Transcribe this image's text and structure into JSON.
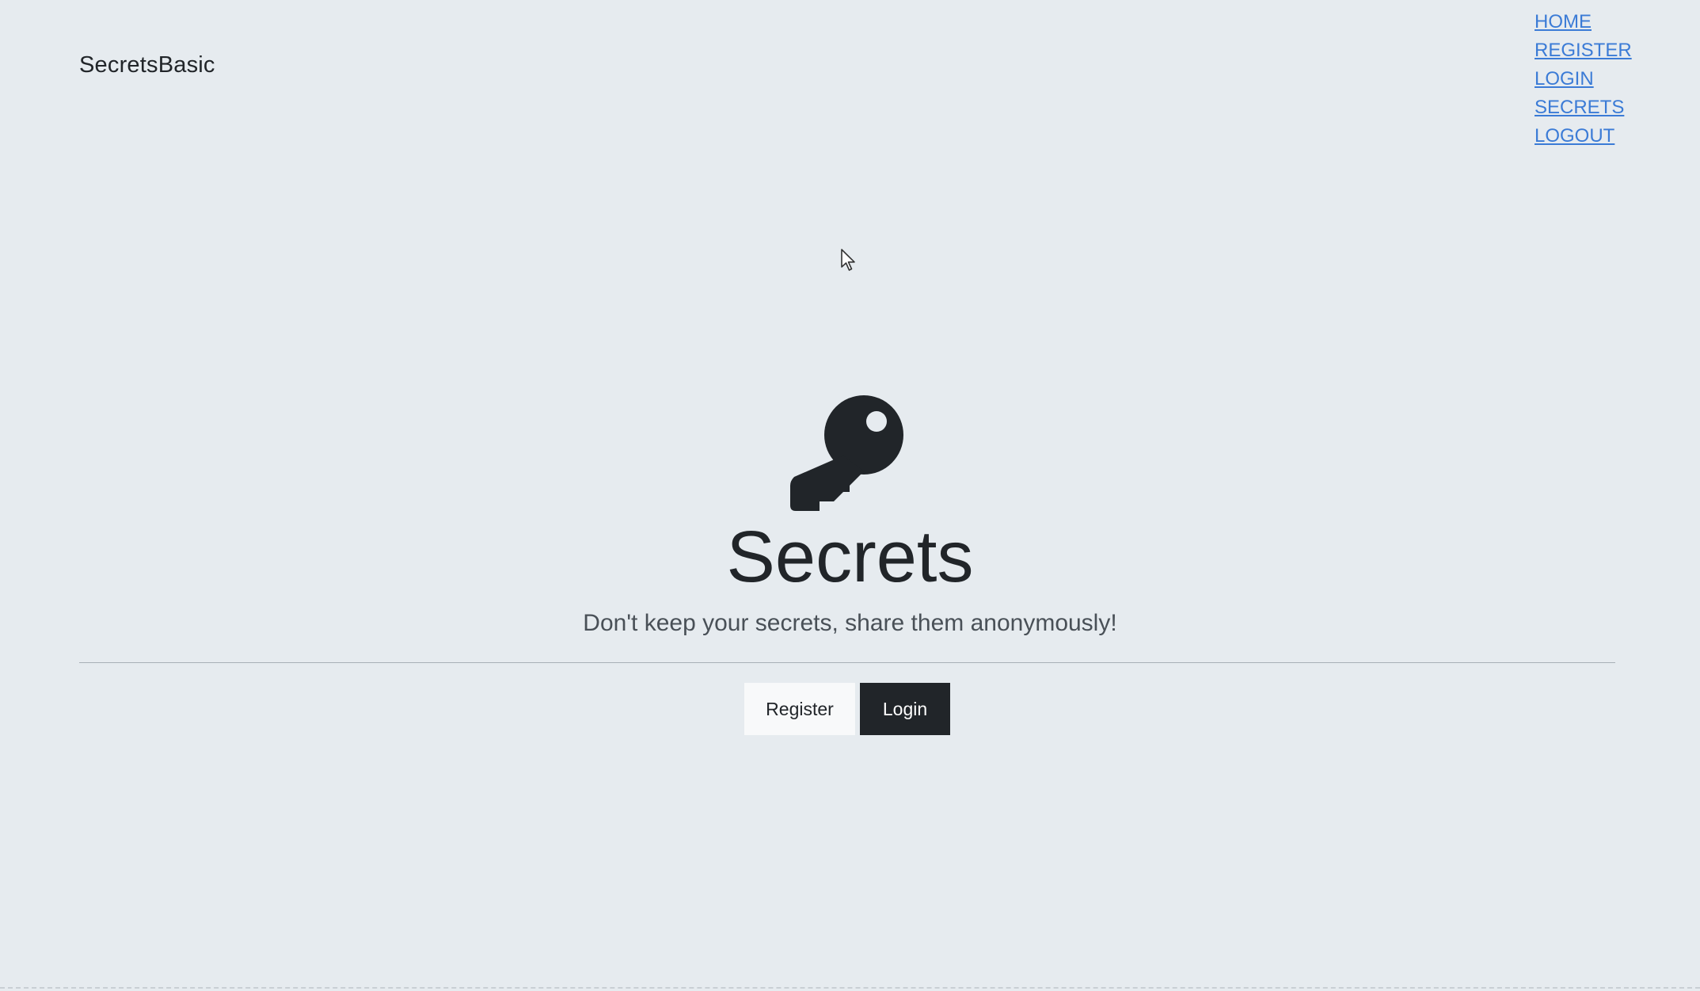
{
  "header": {
    "brand": "SecretsBasic"
  },
  "nav": {
    "items": [
      {
        "label": "HOME"
      },
      {
        "label": "REGISTER"
      },
      {
        "label": "LOGIN"
      },
      {
        "label": "SECRETS"
      },
      {
        "label": "LOGOUT"
      }
    ]
  },
  "hero": {
    "icon": "key-icon",
    "title": "Secrets",
    "subtitle": "Don't keep your secrets, share them anonymously!"
  },
  "actions": {
    "register_label": "Register",
    "login_label": "Login"
  },
  "colors": {
    "background": "#e6ebef",
    "link": "#3b7bd6",
    "dark": "#212529",
    "light": "#f8f9fa"
  }
}
